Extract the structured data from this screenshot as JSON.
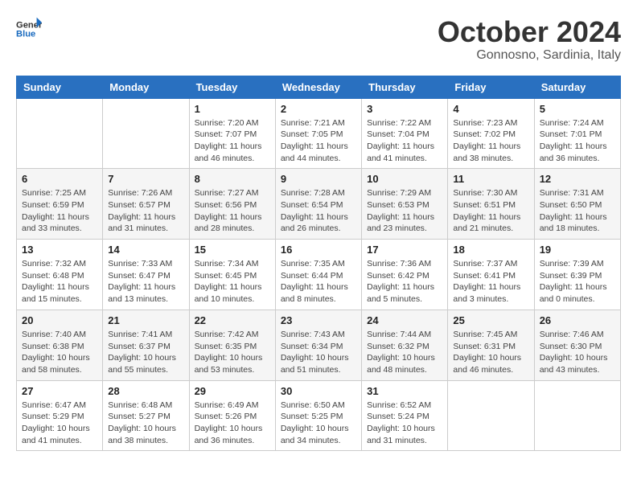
{
  "header": {
    "logo_line1": "General",
    "logo_line2": "Blue",
    "month_title": "October 2024",
    "subtitle": "Gonnosno, Sardinia, Italy"
  },
  "weekdays": [
    "Sunday",
    "Monday",
    "Tuesday",
    "Wednesday",
    "Thursday",
    "Friday",
    "Saturday"
  ],
  "weeks": [
    [
      {
        "day": "",
        "info": ""
      },
      {
        "day": "",
        "info": ""
      },
      {
        "day": "1",
        "info": "Sunrise: 7:20 AM\nSunset: 7:07 PM\nDaylight: 11 hours and 46 minutes."
      },
      {
        "day": "2",
        "info": "Sunrise: 7:21 AM\nSunset: 7:05 PM\nDaylight: 11 hours and 44 minutes."
      },
      {
        "day": "3",
        "info": "Sunrise: 7:22 AM\nSunset: 7:04 PM\nDaylight: 11 hours and 41 minutes."
      },
      {
        "day": "4",
        "info": "Sunrise: 7:23 AM\nSunset: 7:02 PM\nDaylight: 11 hours and 38 minutes."
      },
      {
        "day": "5",
        "info": "Sunrise: 7:24 AM\nSunset: 7:01 PM\nDaylight: 11 hours and 36 minutes."
      }
    ],
    [
      {
        "day": "6",
        "info": "Sunrise: 7:25 AM\nSunset: 6:59 PM\nDaylight: 11 hours and 33 minutes."
      },
      {
        "day": "7",
        "info": "Sunrise: 7:26 AM\nSunset: 6:57 PM\nDaylight: 11 hours and 31 minutes."
      },
      {
        "day": "8",
        "info": "Sunrise: 7:27 AM\nSunset: 6:56 PM\nDaylight: 11 hours and 28 minutes."
      },
      {
        "day": "9",
        "info": "Sunrise: 7:28 AM\nSunset: 6:54 PM\nDaylight: 11 hours and 26 minutes."
      },
      {
        "day": "10",
        "info": "Sunrise: 7:29 AM\nSunset: 6:53 PM\nDaylight: 11 hours and 23 minutes."
      },
      {
        "day": "11",
        "info": "Sunrise: 7:30 AM\nSunset: 6:51 PM\nDaylight: 11 hours and 21 minutes."
      },
      {
        "day": "12",
        "info": "Sunrise: 7:31 AM\nSunset: 6:50 PM\nDaylight: 11 hours and 18 minutes."
      }
    ],
    [
      {
        "day": "13",
        "info": "Sunrise: 7:32 AM\nSunset: 6:48 PM\nDaylight: 11 hours and 15 minutes."
      },
      {
        "day": "14",
        "info": "Sunrise: 7:33 AM\nSunset: 6:47 PM\nDaylight: 11 hours and 13 minutes."
      },
      {
        "day": "15",
        "info": "Sunrise: 7:34 AM\nSunset: 6:45 PM\nDaylight: 11 hours and 10 minutes."
      },
      {
        "day": "16",
        "info": "Sunrise: 7:35 AM\nSunset: 6:44 PM\nDaylight: 11 hours and 8 minutes."
      },
      {
        "day": "17",
        "info": "Sunrise: 7:36 AM\nSunset: 6:42 PM\nDaylight: 11 hours and 5 minutes."
      },
      {
        "day": "18",
        "info": "Sunrise: 7:37 AM\nSunset: 6:41 PM\nDaylight: 11 hours and 3 minutes."
      },
      {
        "day": "19",
        "info": "Sunrise: 7:39 AM\nSunset: 6:39 PM\nDaylight: 11 hours and 0 minutes."
      }
    ],
    [
      {
        "day": "20",
        "info": "Sunrise: 7:40 AM\nSunset: 6:38 PM\nDaylight: 10 hours and 58 minutes."
      },
      {
        "day": "21",
        "info": "Sunrise: 7:41 AM\nSunset: 6:37 PM\nDaylight: 10 hours and 55 minutes."
      },
      {
        "day": "22",
        "info": "Sunrise: 7:42 AM\nSunset: 6:35 PM\nDaylight: 10 hours and 53 minutes."
      },
      {
        "day": "23",
        "info": "Sunrise: 7:43 AM\nSunset: 6:34 PM\nDaylight: 10 hours and 51 minutes."
      },
      {
        "day": "24",
        "info": "Sunrise: 7:44 AM\nSunset: 6:32 PM\nDaylight: 10 hours and 48 minutes."
      },
      {
        "day": "25",
        "info": "Sunrise: 7:45 AM\nSunset: 6:31 PM\nDaylight: 10 hours and 46 minutes."
      },
      {
        "day": "26",
        "info": "Sunrise: 7:46 AM\nSunset: 6:30 PM\nDaylight: 10 hours and 43 minutes."
      }
    ],
    [
      {
        "day": "27",
        "info": "Sunrise: 6:47 AM\nSunset: 5:29 PM\nDaylight: 10 hours and 41 minutes."
      },
      {
        "day": "28",
        "info": "Sunrise: 6:48 AM\nSunset: 5:27 PM\nDaylight: 10 hours and 38 minutes."
      },
      {
        "day": "29",
        "info": "Sunrise: 6:49 AM\nSunset: 5:26 PM\nDaylight: 10 hours and 36 minutes."
      },
      {
        "day": "30",
        "info": "Sunrise: 6:50 AM\nSunset: 5:25 PM\nDaylight: 10 hours and 34 minutes."
      },
      {
        "day": "31",
        "info": "Sunrise: 6:52 AM\nSunset: 5:24 PM\nDaylight: 10 hours and 31 minutes."
      },
      {
        "day": "",
        "info": ""
      },
      {
        "day": "",
        "info": ""
      }
    ]
  ]
}
